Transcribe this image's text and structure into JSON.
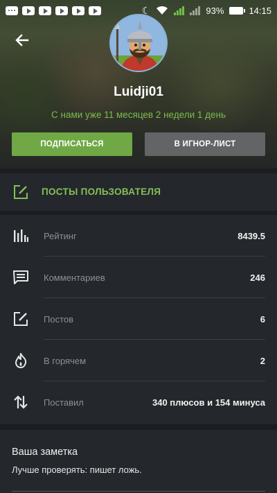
{
  "status_bar": {
    "battery": "93%",
    "time": "14:15"
  },
  "header": {
    "username": "Luidji01",
    "member_since": "С нами уже 11 месяцев 2 недели 1 день",
    "subscribe_label": "ПОДПИСАТЬСЯ",
    "ignore_label": "В ИГНОР-ЛИСТ"
  },
  "posts_link": {
    "label": "ПОСТЫ ПОЛЬЗОВАТЕЛЯ"
  },
  "stats": [
    {
      "name": "Рейтинг",
      "value": "8439.5",
      "icon": "rating-bars-icon"
    },
    {
      "name": "Комментариев",
      "value": "246",
      "icon": "comment-icon"
    },
    {
      "name": "Постов",
      "value": "6",
      "icon": "post-edit-icon"
    },
    {
      "name": "В горячем",
      "value": "2",
      "icon": "flame-icon"
    },
    {
      "name": "Поставил",
      "value": "340 плюсов и 154 минуса",
      "icon": "up-down-arrows-icon"
    }
  ],
  "note": {
    "title": "Ваша заметка",
    "text": "Лучше проверять: пишет ложь."
  },
  "colors": {
    "accent_green": "#6fa845",
    "link_green": "#84c058",
    "ignore_gray": "#626466",
    "panel": "#24272b",
    "background": "#1b1d20"
  }
}
